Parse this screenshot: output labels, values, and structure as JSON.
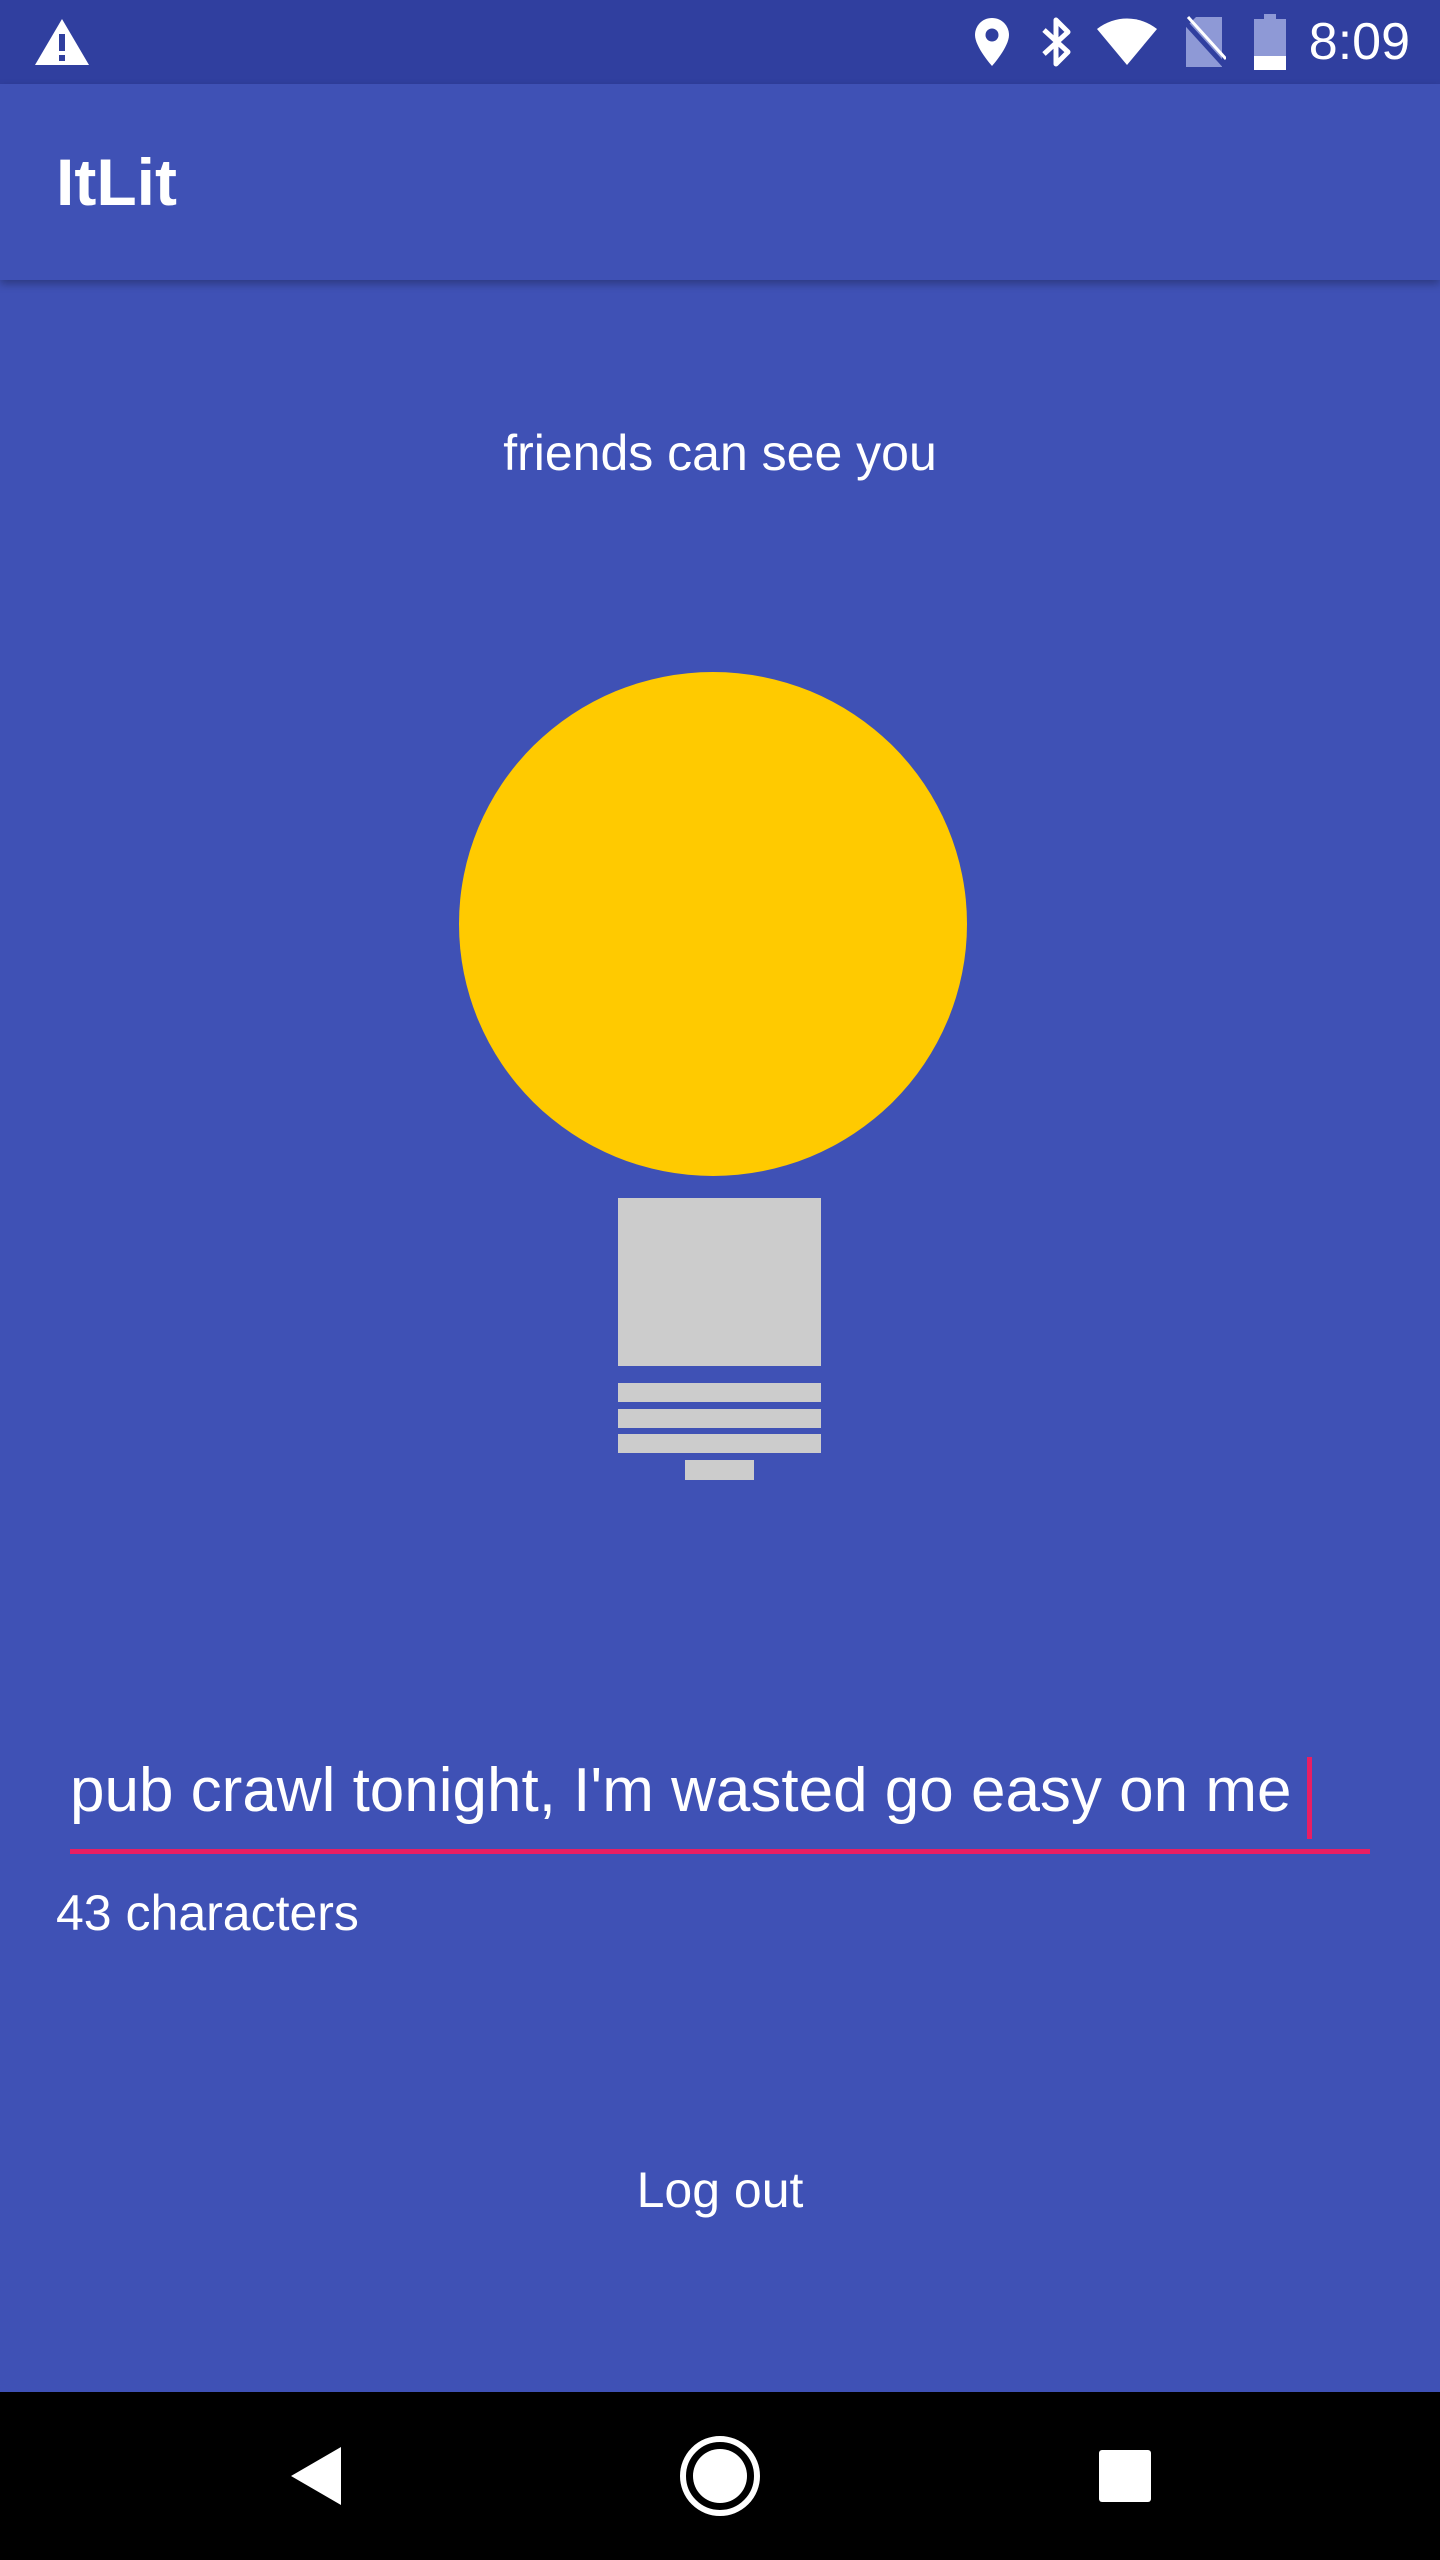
{
  "status_bar": {
    "time": "8:09",
    "icons": [
      "warning-icon",
      "location-icon",
      "bluetooth-icon",
      "wifi-icon",
      "no-sim-icon",
      "battery-icon"
    ]
  },
  "app_bar": {
    "title": "ItLit"
  },
  "main": {
    "status_text": "friends can see you",
    "bulb_state": "lit",
    "message_input": {
      "value": "pub crawl tonight, I'm wasted go easy on me"
    },
    "char_count": "43 characters",
    "logout_label": "Log out"
  },
  "navigation_bar": {
    "icons": [
      "back-icon",
      "home-icon",
      "recents-icon"
    ]
  },
  "colors": {
    "primary": "#3F51B5",
    "primary_dark": "#303F9F",
    "accent": "#E91E63",
    "bulb_lit": "#FFCA00",
    "bulb_base": "#CCCCCC"
  }
}
